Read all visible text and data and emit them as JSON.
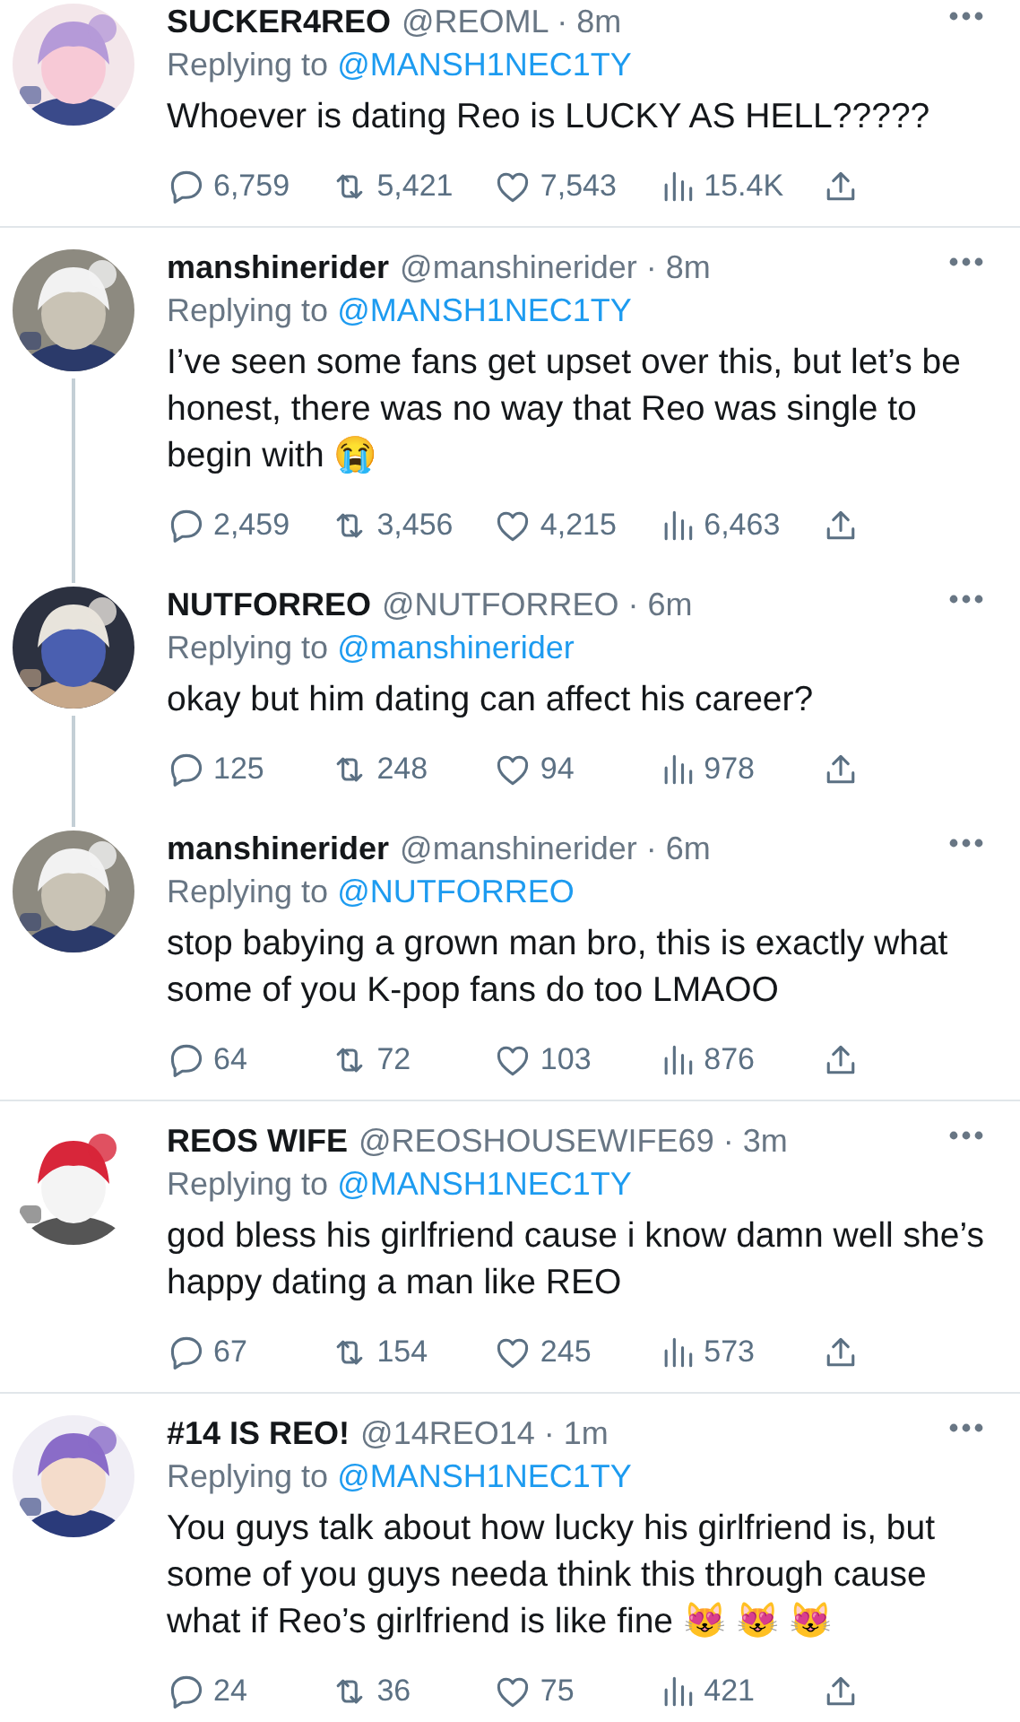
{
  "tweets": [
    {
      "name": "SUCKER4REO",
      "meta": "@REOML · 8m",
      "replying_label": "Replying to",
      "replying_to": "@MANSH1NEC1TY",
      "text": "Whoever is dating Reo is LUCKY AS HELL?????",
      "connected_below": false,
      "stats": {
        "replies": "6,759",
        "retweets": "5,421",
        "likes": "7,543",
        "views": "15.4K"
      }
    },
    {
      "name": "manshinerider",
      "meta": "@manshinerider · 8m",
      "replying_label": "Replying to",
      "replying_to": "@MANSH1NEC1TY",
      "text": "I’ve seen some fans get upset over this, but let’s be honest, there was no way that Reo was single to begin with 😭",
      "connected_below": true,
      "stats": {
        "replies": "2,459",
        "retweets": "3,456",
        "likes": "4,215",
        "views": "6,463"
      }
    },
    {
      "name": "NUTFORREO",
      "meta": "@NUTFORREO · 6m",
      "replying_label": "Replying to",
      "replying_to": "@manshinerider",
      "text": "okay but him dating can affect his career?",
      "connected_below": true,
      "stats": {
        "replies": "125",
        "retweets": "248",
        "likes": "94",
        "views": "978"
      }
    },
    {
      "name": "manshinerider",
      "meta": "@manshinerider · 6m",
      "replying_label": "Replying to",
      "replying_to": "@NUTFORREO",
      "text": "stop babying a grown man bro, this is exactly what some of you K-pop fans do too LMAOO",
      "connected_below": false,
      "stats": {
        "replies": "64",
        "retweets": "72",
        "likes": "103",
        "views": "876"
      }
    },
    {
      "name": "REOS WIFE",
      "meta": "@REOSHOUSEWIFE69 · 3m",
      "replying_label": "Replying to",
      "replying_to": "@MANSH1NEC1TY",
      "text": "god bless his girlfriend cause i know damn well she’s happy dating a man like REO",
      "connected_below": false,
      "stats": {
        "replies": "67",
        "retweets": "154",
        "likes": "245",
        "views": "573"
      }
    },
    {
      "name": "#14 IS REO!",
      "meta": "@14REO14 · 1m",
      "replying_label": "Replying to",
      "replying_to": "@MANSH1NEC1TY",
      "text": "You guys talk about how lucky his girlfriend is, but some of you guys needa think this through cause what if Reo’s girlfriend is like fine 😻 😻 😻",
      "connected_below": false,
      "stats": {
        "replies": "24",
        "retweets": "36",
        "likes": "75",
        "views": "421"
      }
    }
  ]
}
